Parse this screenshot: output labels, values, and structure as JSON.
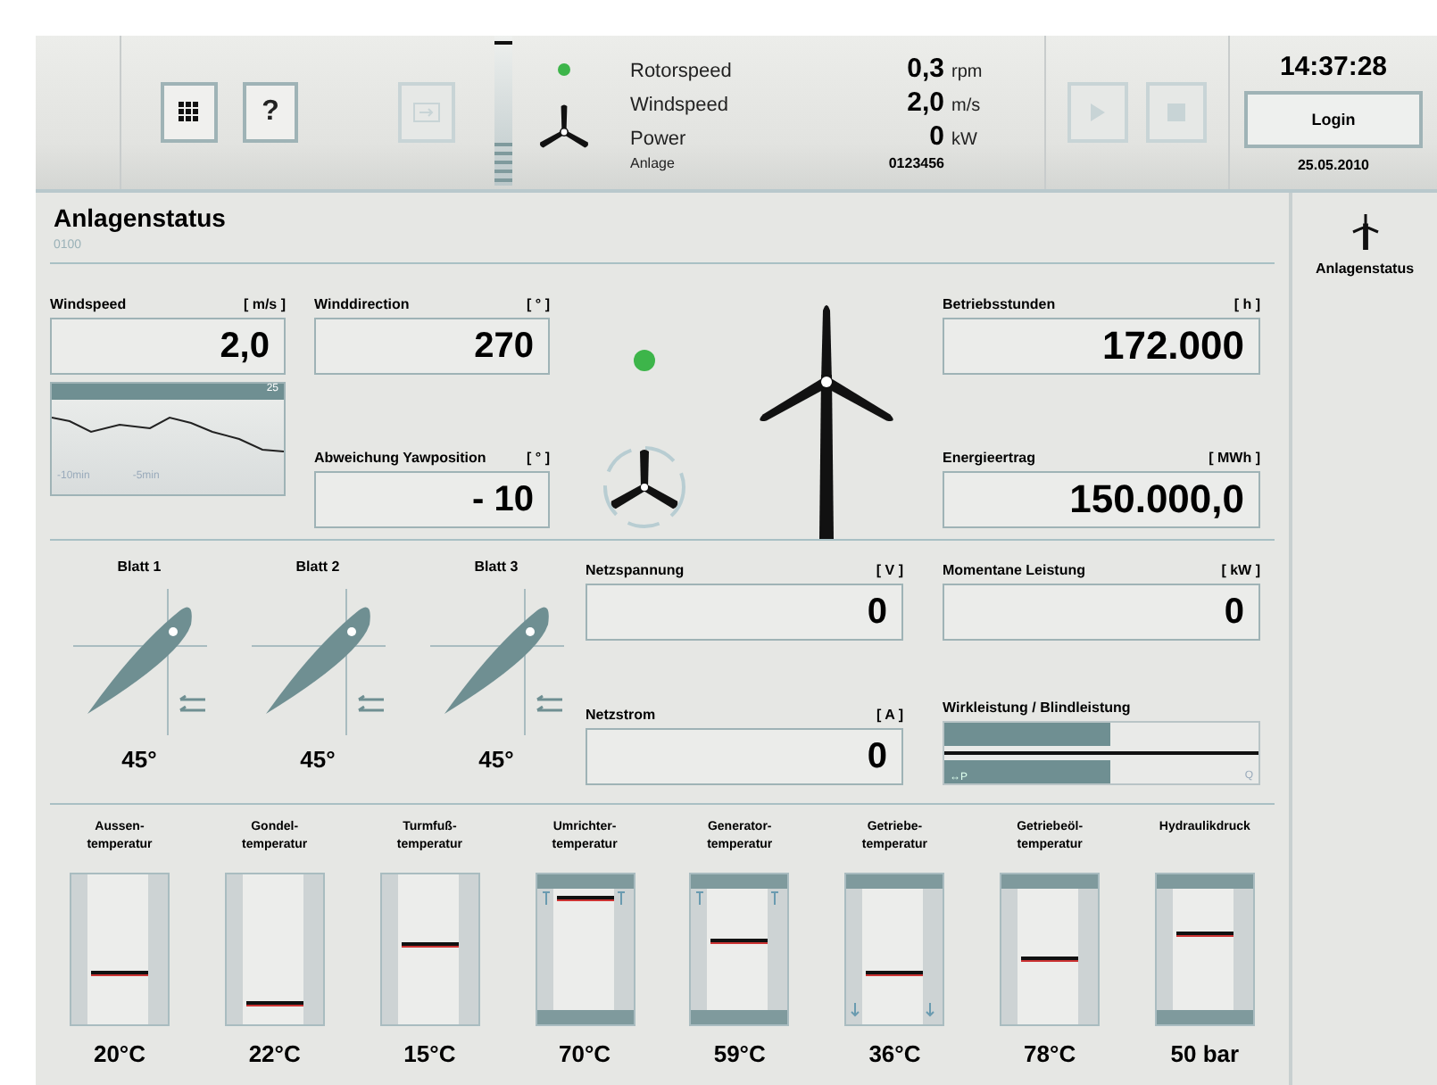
{
  "top_bar": {
    "buttons": [
      {
        "kind": "grid",
        "disabled": false
      },
      {
        "kind": "help",
        "label": "?",
        "disabled": false
      },
      {
        "kind": "export",
        "disabled": true
      }
    ],
    "status_on": true,
    "readings": [
      {
        "label": "Rotorspeed",
        "value": "0,3",
        "unit": "rpm"
      },
      {
        "label": "Windspeed",
        "value": "2,0",
        "unit": "m/s"
      },
      {
        "label": "Power",
        "value": "0",
        "unit": "kW"
      }
    ],
    "plant": {
      "label": "Anlage",
      "value": "0123456"
    },
    "media_buttons": [
      {
        "kind": "play",
        "disabled": true
      },
      {
        "kind": "stop",
        "disabled": true
      }
    ],
    "time": "14:37:28",
    "login": "Login",
    "date": "25.05.2010"
  },
  "page": {
    "title": "Anlagenstatus",
    "code": "0100"
  },
  "sidebar": {
    "items": [
      {
        "label": "Anlagenstatus",
        "selected": true
      }
    ]
  },
  "windspeed": {
    "label": "Windspeed",
    "unit": "[ m/s ]",
    "value": "2,0",
    "trend_max": "25",
    "trend_left": "-10min",
    "trend_mid": "-5min"
  },
  "winddirection": {
    "label": "Winddirection",
    "unit": "[ ° ]",
    "value": "270"
  },
  "yaw": {
    "label": "Abweichung Yawposition",
    "unit": "[ ° ]",
    "value": "- 10"
  },
  "turbine_on": true,
  "operating_hours": {
    "label": "Betriebsstunden",
    "unit": "[ h ]",
    "value": "172.000"
  },
  "energy": {
    "label": "Energieertrag",
    "unit": "[ MWh ]",
    "value": "150.000,0"
  },
  "blades": [
    {
      "label": "Blatt 1",
      "angle": "45°"
    },
    {
      "label": "Blatt 2",
      "angle": "45°"
    },
    {
      "label": "Blatt 3",
      "angle": "45°"
    }
  ],
  "grid_voltage": {
    "label": "Netzspannung",
    "unit": "[ V ]",
    "value": "0"
  },
  "grid_current": {
    "label": "Netzstrom",
    "unit": "[ A ]",
    "value": "0"
  },
  "momentary_power": {
    "label": "Momentane Leistung",
    "unit": "[ kW ]",
    "value": "0"
  },
  "power_ratio": {
    "label": "Wirkleistung / Blindleistung",
    "level": 0.53,
    "p_label": "↔P",
    "q_label": "Q"
  },
  "gauges": [
    {
      "label": "Aussen-\ntemperatur",
      "value": "20°C",
      "level": 0.33,
      "top_band": false,
      "bottom_band": false,
      "arrows_up": false,
      "arrows_down": false
    },
    {
      "label": "Gondel-\ntemperatur",
      "value": "22°C",
      "level": 0.13,
      "top_band": false,
      "bottom_band": false,
      "arrows_up": false,
      "arrows_down": false
    },
    {
      "label": "Turmfuß-\ntemperatur",
      "value": "15°C",
      "level": 0.52,
      "top_band": false,
      "bottom_band": false,
      "arrows_up": false,
      "arrows_down": false
    },
    {
      "label": "Umrichter-\ntemperatur",
      "value": "70°C",
      "level": 0.83,
      "top_band": true,
      "bottom_band": true,
      "arrows_up": true,
      "arrows_down": false
    },
    {
      "label": "Generator-\ntemperatur",
      "value": "59°C",
      "level": 0.55,
      "top_band": true,
      "bottom_band": true,
      "arrows_up": true,
      "arrows_down": false
    },
    {
      "label": "Getriebe-\ntemperatur",
      "value": "36°C",
      "level": 0.33,
      "top_band": true,
      "bottom_band": false,
      "arrows_up": false,
      "arrows_down": true
    },
    {
      "label": "Getriebeöl-\ntemperatur",
      "value": "78°C",
      "level": 0.43,
      "top_band": true,
      "bottom_band": false,
      "arrows_up": false,
      "arrows_down": false
    },
    {
      "label": "Hydraulikdruck",
      "value": "50 bar",
      "level": 0.6,
      "top_band": true,
      "bottom_band": true,
      "arrows_up": false,
      "arrows_down": false
    }
  ]
}
